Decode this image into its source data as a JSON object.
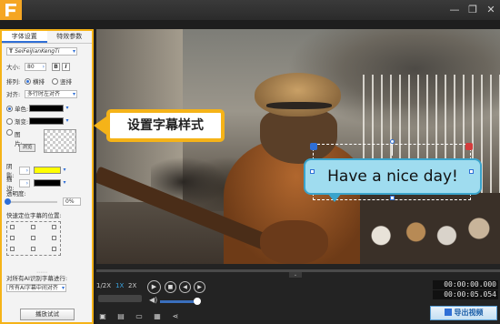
{
  "window": {
    "minimize": "—",
    "restore": "❐",
    "close": "✕"
  },
  "panel": {
    "tabs": [
      "字体设置",
      "特效参数"
    ],
    "font_name": "SeiFeiJianKengTi",
    "size_label": "大小:",
    "size_value": "80",
    "bold": "B",
    "italic": "I",
    "layout_label": "排列:",
    "horizontal": "横排",
    "vertical": "竖排",
    "align_label": "对齐:",
    "align_value": "多行时左对齐",
    "solid_label": "单色:",
    "gradient_label": "渐变:",
    "image_label": "图片:",
    "browse": "浏览",
    "shadow_label": "阴影:",
    "stroke_label": "描边:",
    "opacity_label": "透明度:",
    "opacity_value": "0%",
    "position_label": "快速定位字幕的位置:",
    "ai_label": "对所有AI识别字幕进行:",
    "ai_value": "所有AI字幕中间对齐",
    "apply": "播放试试",
    "colors": {
      "solid": "#000000",
      "gradient": "#000000",
      "shadow": "#ffff00",
      "stroke": "#000000"
    }
  },
  "preview": {
    "label_text": "设置字幕样式",
    "caption_text": "Have a nice day!"
  },
  "player": {
    "speeds": [
      "1/2X",
      "1X",
      "2X"
    ],
    "current_time": "00:00:00.000",
    "total_time": "00:00:05.054",
    "export": "导出视频",
    "volume": 0.85
  }
}
